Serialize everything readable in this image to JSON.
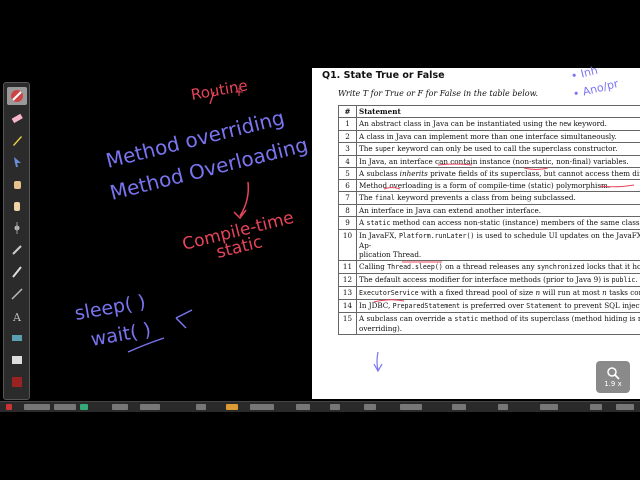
{
  "toolbar": {
    "tools": [
      {
        "icon": "eraser-all-icon",
        "active": true
      },
      {
        "icon": "eraser-icon"
      },
      {
        "icon": "pen-icon"
      },
      {
        "icon": "pointer-icon"
      },
      {
        "icon": "grab-hand-icon"
      },
      {
        "icon": "hand-icon"
      },
      {
        "icon": "laser-pointer-icon"
      },
      {
        "icon": "wand-icon"
      },
      {
        "icon": "brush-icon"
      },
      {
        "icon": "line-icon"
      },
      {
        "icon": "text-icon"
      },
      {
        "icon": "highlight-icon"
      },
      {
        "icon": "whiteboard-icon"
      },
      {
        "icon": "record-icon"
      }
    ]
  },
  "document": {
    "title": "Q1. State True or False",
    "instruction": "Write T for True or F for False in the table below.",
    "columns": [
      "#",
      "Statement"
    ],
    "rows": [
      {
        "n": "1",
        "html": "An abstract class in Java can be instantiated using the <span class=\"code\">new</span> keyword."
      },
      {
        "n": "2",
        "html": "A class in Java can implement more than one interface simultaneously."
      },
      {
        "n": "3",
        "html": "The <span class=\"code\">super</span> keyword can only be used to call the superclass constructor."
      },
      {
        "n": "4",
        "html": "In Java, an interface can contain instance (non-static, non-final) variables."
      },
      {
        "n": "5",
        "html": "A subclass <i>inherits</i> private fields of its superclass, but cannot access them directly."
      },
      {
        "n": "6",
        "html": "Method overloading is a form of compile-time (static) polymorphism."
      },
      {
        "n": "7",
        "html": "The <span class=\"code\">final</span> keyword prevents a class from being subclassed."
      },
      {
        "n": "8",
        "html": "An interface in Java can extend another interface."
      },
      {
        "n": "9",
        "html": "A <span class=\"code\">static</span> method can access non-static (instance) members of the same class."
      },
      {
        "n": "10",
        "html": "In JavaFX, <span class=\"code\">Platform.runLater()</span> is used to schedule UI updates on the JavaFX Ap-<br>plication Thread.",
        "wrap": true
      },
      {
        "n": "11",
        "html": "Calling <span class=\"code\">Thread.sleep()</span> on a thread releases any <span class=\"code\">synchronized</span> locks that it holds."
      },
      {
        "n": "12",
        "html": "The default access modifier for interface methods (prior to Java 9) is <span class=\"code\">public</span>."
      },
      {
        "n": "13",
        "html": "<span class=\"code\">ExecutorService</span> with a fixed thread pool of size <i>n</i> will run at most <i>n</i> tasks concurrently."
      },
      {
        "n": "14",
        "html": "In JDBC, <span class=\"code\">PreparedStatement</span> is preferred over <span class=\"code\">Statement</span> to prevent SQL injection."
      },
      {
        "n": "15",
        "html": "A subclass can override a <span class=\"code\">static</span> method of its superclass (method hiding is not<br>overriding).",
        "wrap": true
      }
    ]
  },
  "annotations": {
    "left": {
      "routine": "Routine",
      "method_overriding": "Method overriding",
      "method_overloading": "Method Overloading",
      "compile_time": "Compile-time",
      "static": "static",
      "sleep": "sleep( )",
      "wait": "wait( )"
    },
    "right": {
      "line1": "• Inh",
      "line2": "• Ano/pr"
    }
  },
  "zoom": {
    "label": "1.9 x"
  },
  "colors": {
    "pen_purple": "#7a74f0",
    "pen_red": "#e8445a",
    "background": "#000000"
  }
}
